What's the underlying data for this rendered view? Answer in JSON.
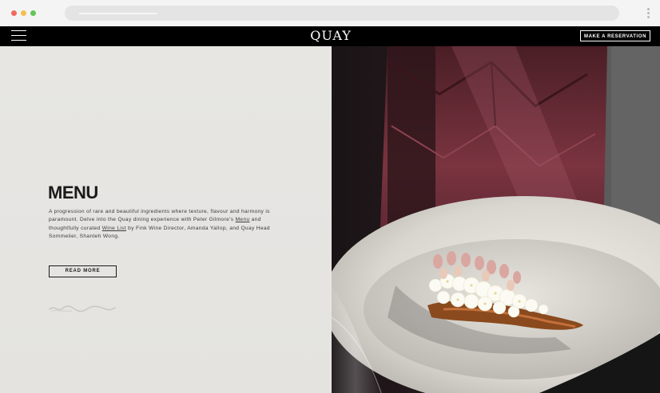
{
  "header": {
    "logo_text": "QUAY",
    "reservation_label": "MAKE A RESERVATION"
  },
  "menu_section": {
    "title": "MENU",
    "desc_before_menu": "A progression of rare and beautiful ingredients where texture, flavour and harmony is paramount. Delve into the Quay dining experience with Peter Gilmore's ",
    "menu_link": "Menu",
    "desc_between": " and thoughtfully curated ",
    "wine_link": "Wine List",
    "desc_after": " by Fink Wine Director, Amanda Yallop, and Quay Head Sommelier, Shanteh Wong.",
    "read_more_label": "READ MORE"
  },
  "icons": {
    "menu": "hamburger-menu-icon",
    "browser_menu": "kebab-menu-icon"
  },
  "colors": {
    "header_bg": "#000000",
    "panel_bg": "#e6e5e2",
    "text_dark": "#1a1a1a",
    "leather": "#6a2a35"
  }
}
